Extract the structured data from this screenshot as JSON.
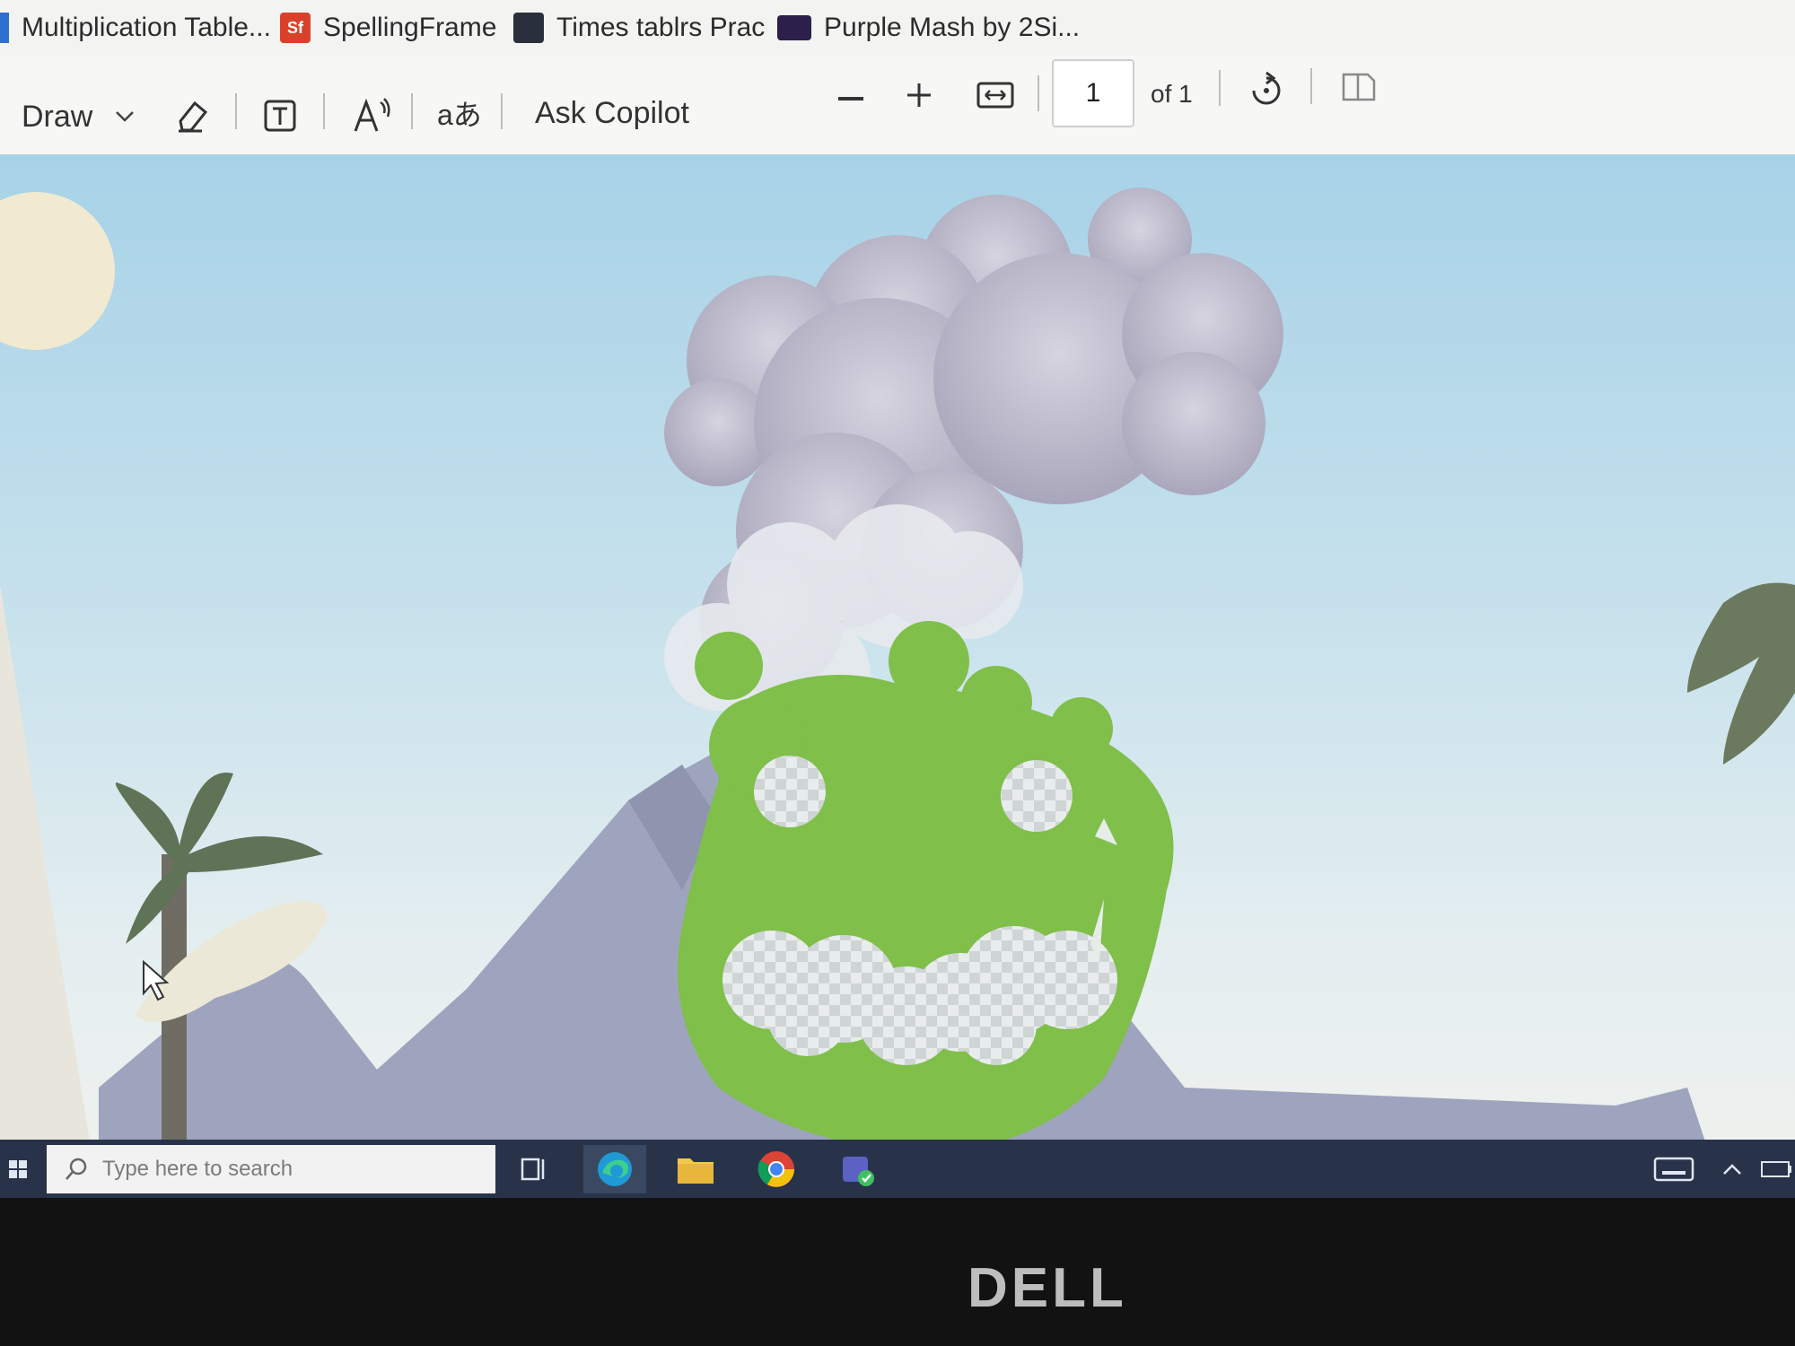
{
  "bookmarks": [
    {
      "label": "Multiplication Table...",
      "favicon": "blue-bar"
    },
    {
      "label": "SpellingFrame",
      "favicon_text": "Sf",
      "color": "#d9412b"
    },
    {
      "label": "Times tablrs Prac",
      "favicon": "dark-square"
    },
    {
      "label": "Purple Mash by 2Si...",
      "favicon": "purple-square"
    }
  ],
  "toolbar": {
    "draw_label": "Draw",
    "ask_copilot_label": "Ask Copilot",
    "page_current": "1",
    "page_total_label": "of 1",
    "icons": [
      "chevron-down-icon",
      "eraser-icon",
      "text-box-icon",
      "read-aloud-icon",
      "translate-icon",
      "zoom-out-icon",
      "zoom-in-icon",
      "fit-width-icon",
      "rotate-icon",
      "page-view-icon"
    ]
  },
  "taskbar": {
    "search_placeholder": "Type here to search",
    "apps": [
      "task-view-icon",
      "edge-icon",
      "file-explorer-icon",
      "chrome-icon",
      "teams-icon"
    ]
  },
  "bezel": {
    "brand": "DELL"
  },
  "colors": {
    "sky": "#b9dbe9",
    "monster_green": "#7fbf4a",
    "smoke": "#b7b3c5",
    "volcano": "#9ea4bd",
    "taskbar": "#28334a"
  }
}
